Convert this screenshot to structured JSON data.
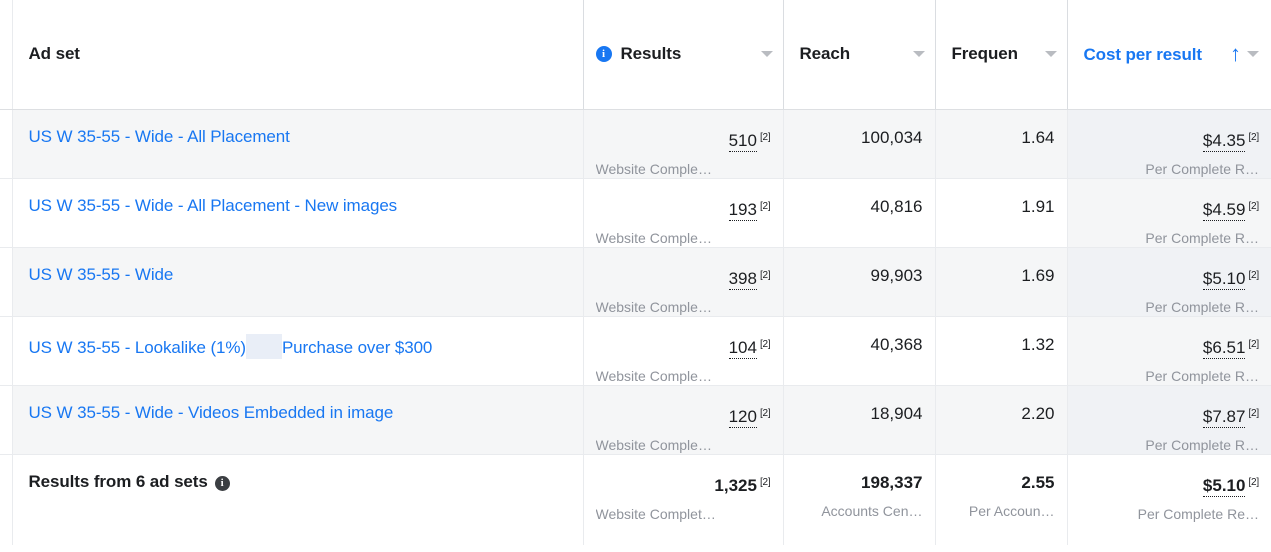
{
  "table": {
    "columns": [
      {
        "key": "adset",
        "label": "Ad set",
        "align": "left",
        "info_icon": false,
        "caret": false,
        "sorted": false,
        "blue": false
      },
      {
        "key": "results",
        "label": "Results",
        "align": "right",
        "info_icon": true,
        "caret": true,
        "sorted": false,
        "blue": false
      },
      {
        "key": "reach",
        "label": "Reach",
        "align": "right",
        "info_icon": false,
        "caret": true,
        "sorted": false,
        "blue": false
      },
      {
        "key": "freq",
        "label": "Frequen",
        "align": "right",
        "info_icon": false,
        "caret": true,
        "sorted": false,
        "blue": false
      },
      {
        "key": "cpr",
        "label": "Cost per result",
        "align": "right",
        "info_icon": false,
        "caret": true,
        "sorted": true,
        "blue": true
      }
    ],
    "sort": {
      "column": "cpr",
      "direction": "ascending",
      "arrow_glyph": "↑"
    },
    "icons": {
      "info_blue": "info-icon",
      "info_dark": "info-icon",
      "caret_down": "chevron-down-icon",
      "sort_asc": "sort-ascending-arrow-icon"
    },
    "footnote_marker": "[2]",
    "rows": [
      {
        "adset_name": "US W 35-55 - Wide - All Placement",
        "adset_name_part1": "US W 35-55 - Wide - All Placement",
        "adset_name_part2": "",
        "highlight_gap": false,
        "results_value": "510",
        "results_sub": "Website Comple…",
        "results_footnote": "[2]",
        "reach_value": "100,034",
        "reach_sub": "",
        "frequency_value": "1.64",
        "frequency_sub": "",
        "cpr_value": "$4.35",
        "cpr_sub": "Per Complete R…",
        "cpr_footnote": "[2]"
      },
      {
        "adset_name": "US W 35-55 - Wide - All Placement - New images",
        "adset_name_part1": "US W 35-55 - Wide - All Placement - New images",
        "adset_name_part2": "",
        "highlight_gap": false,
        "results_value": "193",
        "results_sub": "Website Comple…",
        "results_footnote": "[2]",
        "reach_value": "40,816",
        "reach_sub": "",
        "frequency_value": "1.91",
        "frequency_sub": "",
        "cpr_value": "$4.59",
        "cpr_sub": "Per Complete R…",
        "cpr_footnote": "[2]"
      },
      {
        "adset_name": "US W 35-55 - Wide",
        "adset_name_part1": "US W 35-55 - Wide",
        "adset_name_part2": "",
        "highlight_gap": false,
        "results_value": "398",
        "results_sub": "Website Comple…",
        "results_footnote": "[2]",
        "reach_value": "99,903",
        "reach_sub": "",
        "frequency_value": "1.69",
        "frequency_sub": "",
        "cpr_value": "$5.10",
        "cpr_sub": "Per Complete R…",
        "cpr_footnote": "[2]"
      },
      {
        "adset_name": "US W 35-55 - Lookalike (1%)  Purchase over $300",
        "adset_name_part1": "US W 35-55 - Lookalike (1%)",
        "adset_name_part2": "Purchase over $300",
        "highlight_gap": true,
        "results_value": "104",
        "results_sub": "Website Comple…",
        "results_footnote": "[2]",
        "reach_value": "40,368",
        "reach_sub": "",
        "frequency_value": "1.32",
        "frequency_sub": "",
        "cpr_value": "$6.51",
        "cpr_sub": "Per Complete R…",
        "cpr_footnote": "[2]"
      },
      {
        "adset_name": "US W 35-55 - Wide - Videos Embedded in image",
        "adset_name_part1": "US W 35-55 - Wide - Videos Embedded in image",
        "adset_name_part2": "",
        "highlight_gap": false,
        "results_value": "120",
        "results_sub": "Website Comple…",
        "results_footnote": "[2]",
        "reach_value": "18,904",
        "reach_sub": "",
        "frequency_value": "2.20",
        "frequency_sub": "",
        "cpr_value": "$7.87",
        "cpr_sub": "Per Complete R…",
        "cpr_footnote": "[2]"
      }
    ],
    "totals": {
      "label": "Results from 6 ad sets",
      "results_value": "1,325",
      "results_sub": "Website Complet…",
      "results_footnote": "[2]",
      "reach_value": "198,337",
      "reach_sub": "Accounts Cen…",
      "frequency_value": "2.55",
      "frequency_sub": "Per Accoun…",
      "cpr_value": "$5.10",
      "cpr_sub": "Per Complete Re…",
      "cpr_footnote": "[2]"
    }
  },
  "colors": {
    "link_blue": "#1877f2",
    "text_dark": "#1c1e21",
    "text_muted": "#90949c",
    "row_alt_bg": "#f5f6f7",
    "sorted_col_bg": "#f0f2f5",
    "border": "#e9ebee"
  }
}
